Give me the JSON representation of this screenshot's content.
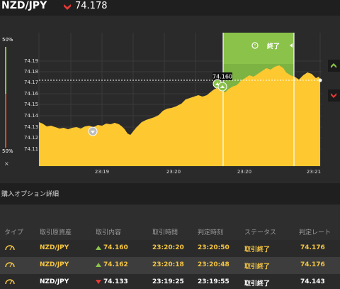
{
  "header": {
    "pair": "NZD/JPY",
    "rate": "74.178",
    "rate_direction_icon": "red-down-arrow-icon"
  },
  "chart": {
    "left_bar": {
      "top_label": "50%",
      "bottom_label": "50%",
      "close_label": "×"
    },
    "y_ticks": [
      "74.19",
      "74.18",
      "74.17",
      "74.16",
      "74.15",
      "74.14",
      "74.13",
      "74.12",
      "74.11"
    ],
    "x_ticks": [
      "23:19",
      "23:20",
      "23:20",
      "23:21"
    ],
    "entry_price_label": "74.160",
    "end_button_label": "終了",
    "colors": {
      "area": "#fec830",
      "highlight": "#7cb342",
      "grid": "#3a3a3a",
      "up": "#8bc34a",
      "down": "#e53935"
    }
  },
  "details": {
    "title": "購入オプション詳細",
    "columns": [
      "タイプ",
      "取引原資産",
      "取引内容",
      "取引時間",
      "判定時刻",
      "ステータス",
      "判定レート"
    ],
    "rows": [
      {
        "type_icon": "gauge-icon",
        "asset": "NZD/JPY",
        "direction": "up",
        "content": "74.160",
        "time": "23:20:20",
        "judge_time": "23:20:50",
        "status": "取引終了",
        "judge_rate": "74.176"
      },
      {
        "type_icon": "gauge-icon",
        "asset": "NZD/JPY",
        "direction": "up",
        "content": "74.162",
        "time": "23:20:18",
        "judge_time": "23:20:48",
        "status": "取引終了",
        "judge_rate": "74.176"
      },
      {
        "type_icon": "gauge-icon",
        "asset": "NZD/JPY",
        "direction": "down",
        "content": "74.133",
        "time": "23:19:25",
        "judge_time": "23:19:55",
        "status": "取引終了",
        "judge_rate": "74.143"
      }
    ]
  }
}
